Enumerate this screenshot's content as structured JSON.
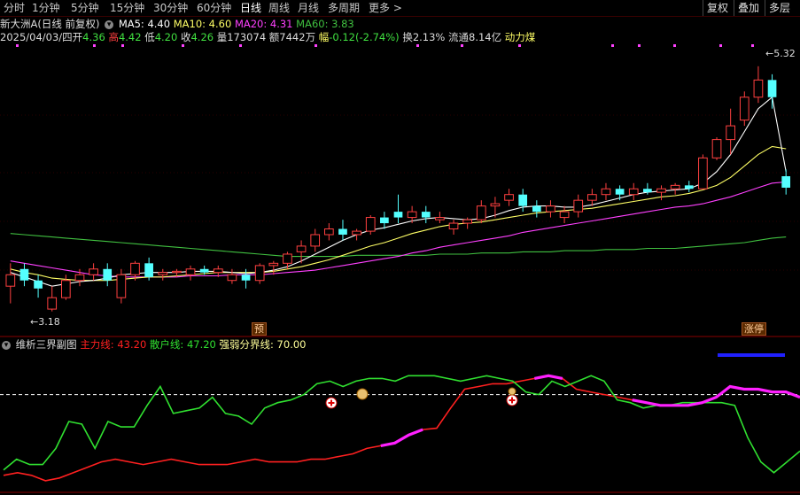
{
  "toolbar": {
    "periods": [
      "分时",
      "1分钟",
      "5分钟",
      "15分钟",
      "30分钟",
      "60分钟",
      "日线",
      "周线",
      "月线",
      "多周期",
      "更多 >"
    ],
    "active": "日线",
    "right_buttons": [
      "复权",
      "叠加",
      "多层"
    ]
  },
  "header": {
    "stock_title": "新大洲A(日线 前复权)",
    "ma5": "MA5: 4.40",
    "ma10": "MA10: 4.60",
    "ma20": "MA20: 4.31",
    "ma60": "MA60: 3.83"
  },
  "quote": {
    "date": "2025/04/03/四",
    "open_label": "开",
    "open": "4.36",
    "high_label": "高",
    "high": "4.42",
    "low_label": "低",
    "low": "4.20",
    "close_label": "收",
    "close": "4.26",
    "vol_label": "量",
    "vol": "173074",
    "amount_label": "额",
    "amount": "7442万",
    "change_label": "幅",
    "change": "-0.12(-2.74%)",
    "turnover_label": "换",
    "turnover": "2.13%",
    "float_label": "流通",
    "float": "8.14亿",
    "sector": "动力煤"
  },
  "price_labels": {
    "high": "5.32",
    "low": "3.18"
  },
  "tags": {
    "pre": "预",
    "limit_up": "涨停"
  },
  "indicator": {
    "title": "维析三界副图",
    "main_label": "主力线: 43.20",
    "retail_label": "散户线: 47.20",
    "boundary_label": "强弱分界线: 70.00"
  },
  "colors": {
    "up": "#ff4040",
    "down": "#54ffff",
    "ma5": "#ffffff",
    "ma10": "#ffff66",
    "ma20": "#ff40ff",
    "ma60": "#40c040",
    "main_line": "#ff2020",
    "retail_line": "#30e030",
    "strong_line": "#ff20ff",
    "boundary": "#ffffff",
    "blue_bar": "#2020ff"
  },
  "chart_data": {
    "type": "candlestick",
    "candles_ohlc": [
      [
        3.4,
        3.6,
        3.25,
        3.5
      ],
      [
        3.55,
        3.6,
        3.4,
        3.45
      ],
      [
        3.45,
        3.5,
        3.3,
        3.38
      ],
      [
        3.2,
        3.4,
        3.18,
        3.3
      ],
      [
        3.3,
        3.5,
        3.28,
        3.45
      ],
      [
        3.45,
        3.55,
        3.4,
        3.5
      ],
      [
        3.5,
        3.6,
        3.45,
        3.55
      ],
      [
        3.55,
        3.6,
        3.4,
        3.45
      ],
      [
        3.3,
        3.55,
        3.25,
        3.5
      ],
      [
        3.5,
        3.62,
        3.45,
        3.6
      ],
      [
        3.6,
        3.65,
        3.45,
        3.48
      ],
      [
        3.5,
        3.55,
        3.45,
        3.52
      ],
      [
        3.52,
        3.55,
        3.48,
        3.53
      ],
      [
        3.5,
        3.58,
        3.45,
        3.55
      ],
      [
        3.55,
        3.58,
        3.5,
        3.52
      ],
      [
        3.52,
        3.58,
        3.48,
        3.55
      ],
      [
        3.45,
        3.55,
        3.42,
        3.5
      ],
      [
        3.5,
        3.55,
        3.38,
        3.45
      ],
      [
        3.45,
        3.6,
        3.42,
        3.58
      ],
      [
        3.58,
        3.62,
        3.5,
        3.6
      ],
      [
        3.6,
        3.7,
        3.55,
        3.68
      ],
      [
        3.7,
        3.8,
        3.6,
        3.75
      ],
      [
        3.75,
        3.9,
        3.7,
        3.85
      ],
      [
        3.85,
        3.95,
        3.8,
        3.9
      ],
      [
        3.9,
        3.98,
        3.8,
        3.85
      ],
      [
        3.85,
        3.9,
        3.8,
        3.88
      ],
      [
        3.88,
        4.02,
        3.85,
        4.0
      ],
      [
        4.0,
        4.05,
        3.9,
        3.95
      ],
      [
        4.05,
        4.2,
        3.95,
        4.0
      ],
      [
        4.0,
        4.1,
        3.95,
        4.05
      ],
      [
        4.05,
        4.1,
        3.95,
        4.0
      ],
      [
        3.98,
        4.05,
        3.95,
        4.0
      ],
      [
        3.9,
        3.98,
        3.85,
        3.95
      ],
      [
        3.95,
        4.0,
        3.9,
        3.98
      ],
      [
        3.98,
        4.15,
        3.95,
        4.1
      ],
      [
        4.1,
        4.18,
        4.0,
        4.12
      ],
      [
        4.15,
        4.25,
        4.1,
        4.2
      ],
      [
        4.2,
        4.25,
        4.05,
        4.1
      ],
      [
        4.1,
        4.15,
        4.0,
        4.05
      ],
      [
        4.05,
        4.15,
        4.0,
        4.1
      ],
      [
        4.0,
        4.1,
        3.95,
        4.05
      ],
      [
        4.05,
        4.2,
        4.0,
        4.15
      ],
      [
        4.15,
        4.25,
        4.1,
        4.2
      ],
      [
        4.2,
        4.3,
        4.15,
        4.25
      ],
      [
        4.25,
        4.28,
        4.15,
        4.2
      ],
      [
        4.2,
        4.3,
        4.15,
        4.25
      ],
      [
        4.25,
        4.3,
        4.2,
        4.22
      ],
      [
        4.22,
        4.28,
        4.15,
        4.25
      ],
      [
        4.25,
        4.3,
        4.2,
        4.28
      ],
      [
        4.28,
        4.32,
        4.22,
        4.25
      ],
      [
        4.25,
        4.55,
        4.25,
        4.52
      ],
      [
        4.52,
        4.7,
        4.5,
        4.68
      ],
      [
        4.68,
        4.95,
        4.55,
        4.8
      ],
      [
        4.85,
        5.1,
        4.8,
        5.05
      ],
      [
        5.05,
        5.32,
        5.0,
        5.2
      ],
      [
        5.2,
        5.25,
        4.95,
        5.05
      ],
      [
        4.36,
        4.42,
        4.2,
        4.26
      ]
    ],
    "ma5": [
      3.52,
      3.48,
      3.44,
      3.4,
      3.42,
      3.44,
      3.45,
      3.47,
      3.5,
      3.51,
      3.52,
      3.52,
      3.52,
      3.53,
      3.53,
      3.53,
      3.52,
      3.51,
      3.52,
      3.54,
      3.57,
      3.62,
      3.68,
      3.74,
      3.8,
      3.85,
      3.89,
      3.91,
      3.94,
      3.97,
      3.99,
      4.0,
      3.99,
      3.98,
      3.99,
      4.02,
      4.06,
      4.09,
      4.1,
      4.1,
      4.09,
      4.09,
      4.11,
      4.14,
      4.17,
      4.2,
      4.22,
      4.23,
      4.24,
      4.25,
      4.3,
      4.4,
      4.55,
      4.75,
      4.95,
      5.05,
      4.4
    ],
    "ma10": [
      3.55,
      3.52,
      3.5,
      3.47,
      3.46,
      3.45,
      3.45,
      3.45,
      3.46,
      3.47,
      3.48,
      3.48,
      3.49,
      3.5,
      3.51,
      3.52,
      3.52,
      3.52,
      3.52,
      3.53,
      3.55,
      3.57,
      3.6,
      3.63,
      3.67,
      3.71,
      3.75,
      3.78,
      3.82,
      3.86,
      3.89,
      3.92,
      3.94,
      3.95,
      3.96,
      3.98,
      4.0,
      4.02,
      4.04,
      4.05,
      4.06,
      4.07,
      4.08,
      4.1,
      4.12,
      4.14,
      4.16,
      4.18,
      4.19,
      4.21,
      4.24,
      4.28,
      4.35,
      4.45,
      4.55,
      4.62,
      4.6
    ],
    "ma20": [
      3.62,
      3.6,
      3.58,
      3.56,
      3.54,
      3.52,
      3.5,
      3.49,
      3.48,
      3.48,
      3.48,
      3.48,
      3.48,
      3.49,
      3.49,
      3.49,
      3.5,
      3.5,
      3.5,
      3.51,
      3.52,
      3.53,
      3.54,
      3.56,
      3.58,
      3.6,
      3.62,
      3.64,
      3.66,
      3.69,
      3.71,
      3.74,
      3.76,
      3.78,
      3.8,
      3.82,
      3.84,
      3.87,
      3.89,
      3.91,
      3.93,
      3.95,
      3.97,
      3.99,
      4.01,
      4.03,
      4.05,
      4.07,
      4.09,
      4.1,
      4.12,
      4.15,
      4.18,
      4.22,
      4.26,
      4.3,
      4.31
    ],
    "ma60": [
      3.86,
      3.85,
      3.84,
      3.83,
      3.82,
      3.81,
      3.8,
      3.79,
      3.78,
      3.77,
      3.76,
      3.75,
      3.74,
      3.73,
      3.72,
      3.71,
      3.7,
      3.69,
      3.68,
      3.67,
      3.66,
      3.66,
      3.66,
      3.66,
      3.66,
      3.67,
      3.67,
      3.67,
      3.67,
      3.67,
      3.67,
      3.68,
      3.68,
      3.68,
      3.69,
      3.69,
      3.69,
      3.7,
      3.7,
      3.7,
      3.71,
      3.71,
      3.71,
      3.72,
      3.72,
      3.72,
      3.73,
      3.73,
      3.73,
      3.74,
      3.75,
      3.76,
      3.77,
      3.78,
      3.8,
      3.82,
      3.83
    ],
    "ylim": [
      3.1,
      5.45
    ],
    "indicator": {
      "ylim": [
        0,
        100
      ],
      "boundary": 70,
      "main_line": [
        10,
        12,
        10,
        6,
        8,
        12,
        16,
        20,
        22,
        20,
        18,
        20,
        22,
        20,
        18,
        18,
        18,
        20,
        22,
        20,
        20,
        20,
        22,
        22,
        24,
        26,
        30,
        32,
        34,
        40,
        44,
        45,
        60,
        74,
        76,
        78,
        78,
        80,
        82,
        84,
        82,
        74,
        72,
        70,
        68,
        66,
        64,
        62,
        62,
        62,
        64,
        68,
        76,
        74,
        74,
        72,
        72,
        68
      ],
      "retail_line": [
        14,
        22,
        18,
        18,
        30,
        50,
        48,
        30,
        50,
        46,
        46,
        62,
        76,
        56,
        58,
        60,
        68,
        56,
        54,
        48,
        60,
        64,
        66,
        70,
        78,
        80,
        76,
        80,
        82,
        82,
        80,
        84,
        84,
        84,
        82,
        80,
        82,
        84,
        82,
        80,
        72,
        70,
        80,
        76,
        80,
        84,
        80,
        66,
        64,
        60,
        62,
        62,
        64,
        64,
        64,
        64,
        62,
        38,
        20,
        12,
        20,
        28
      ]
    }
  }
}
